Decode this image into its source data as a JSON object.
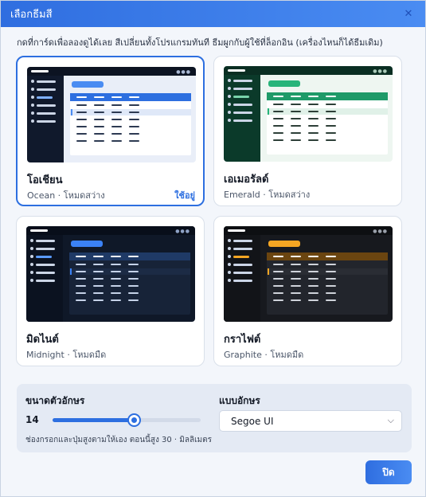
{
  "dialog": {
    "title": "เลือกธีมสี",
    "close_icon": "close-icon",
    "hint": "กดที่การ์ดเพื่อลองดูได้เลย สีเปลี่ยนทั้งโปรแกรมทันที ธีมผูกกับผู้ใช้ที่ล็อกอิน (เครื่องไหนก็ได้ธีมเดิม)"
  },
  "themes": [
    {
      "name": "โอเชียน",
      "sub": "Ocean · โหมดสว่าง",
      "badge": "ใช้อยู่",
      "selected": true,
      "colors": {
        "side": "#10192c",
        "top": "#0c1322",
        "body": "#e9eef8",
        "panel": "#ffffff",
        "accent": "#2d6fe0",
        "pill": "#4a8cf2",
        "row": "#dfe8f8",
        "cell": "#2d3a52",
        "sel": "#7fb0ff",
        "dots": "#a9b8d4"
      }
    },
    {
      "name": "เอเมอรัลด์",
      "sub": "Emerald · โหมดสว่าง",
      "badge": "",
      "selected": false,
      "colors": {
        "side": "#0b3a2a",
        "top": "#0a2e22",
        "body": "#eef6f1",
        "panel": "#ffffff",
        "accent": "#1e9a68",
        "pill": "#27b47a",
        "row": "#e0f1e8",
        "cell": "#2d3f38",
        "sel": "#79d3ab",
        "dots": "#a9c9b8"
      }
    },
    {
      "name": "มิดไนต์",
      "sub": "Midnight · โหมดมืด",
      "badge": "",
      "selected": false,
      "colors": {
        "side": "#0b1220",
        "top": "#080e1a",
        "body": "#0f1828",
        "panel": "#172338",
        "accent": "#1f3a66",
        "pill": "#3b82f6",
        "row": "#1c2b45",
        "cell": "#c5d2e8",
        "sel": "#5a9bff",
        "dots": "#8ea2c6"
      }
    },
    {
      "name": "กราไฟต์",
      "sub": "Graphite · โหมดมืด",
      "badge": "",
      "selected": false,
      "colors": {
        "side": "#121418",
        "top": "#0d0f12",
        "body": "#17191e",
        "panel": "#22252c",
        "accent": "#6b4510",
        "pill": "#f5a623",
        "row": "#2a2d34",
        "cell": "#cfd3da",
        "sel": "#f5a623",
        "dots": "#9aa0aa"
      }
    }
  ],
  "font_size": {
    "label": "ขนาดตัวอักษร",
    "value": "14",
    "fraction": 0.55,
    "note": "ช่องกรอกและปุ่มสูงตามให้เอง ตอนนี้สูง 30 · มิลลิเมตร"
  },
  "font_family": {
    "label": "แบบอักษร",
    "value": "Segoe UI",
    "chevron_icon": "chevron-down-icon"
  },
  "ok_button": "ปิด"
}
